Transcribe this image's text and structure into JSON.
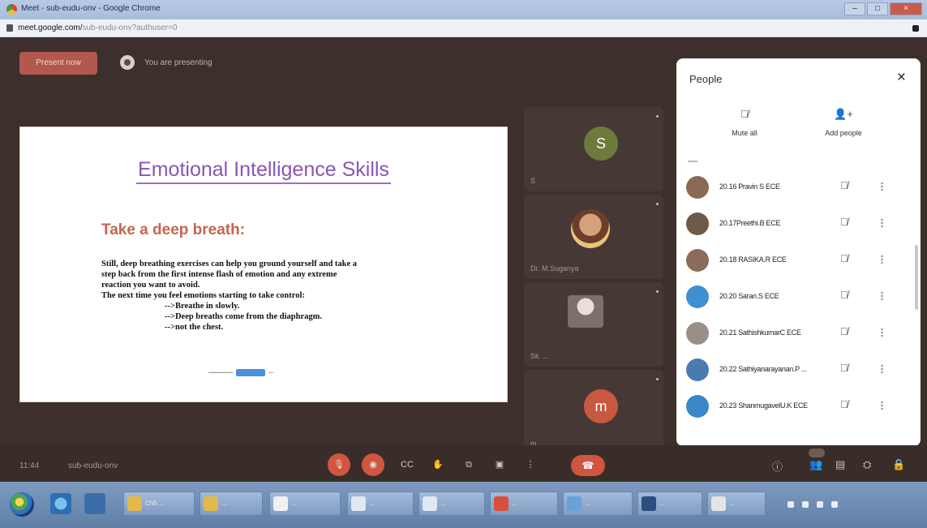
{
  "browser": {
    "title": "Meet - sub-eudu-onv - Google Chrome",
    "url_host": "meet.google.com/",
    "url_path": "sub-eudu-onv?authuser=0"
  },
  "meeting": {
    "presenting_chip": "Present now",
    "presenter_label": "You are presenting",
    "time": "11:44",
    "code": "sub-eudu-onv"
  },
  "slide": {
    "title": "Emotional Intelligence Skills",
    "heading": "Take a deep breath:",
    "body": [
      "Still, deep breathing exercises can help you ground yourself and take a",
      "step back from the first intense flash of emotion and any extreme",
      "reaction you want to avoid.",
      "The next time you feel emotions starting to take control:"
    ],
    "bullets": [
      "-->Breathe in slowly.",
      "-->Deep breaths come from the diaphragm.",
      "-->not the chest."
    ]
  },
  "tiles": [
    {
      "initial": "S",
      "name": "S",
      "color": "#6d7a3c"
    },
    {
      "initial": "",
      "name": "Dr. M.Suganya",
      "color": "#7a5a48"
    },
    {
      "initial": "",
      "name": "Sk. ...",
      "color": "#6e605b"
    },
    {
      "initial": "m",
      "name": "m",
      "color": "#c8583e"
    }
  ],
  "people_panel": {
    "title": "People",
    "close_icon": "×",
    "mute_all_label": "Mute all",
    "add_people_label": "Add people",
    "participants": [
      {
        "name": "20.16 Pravin S ECE",
        "avatar_color": "#8a6a55"
      },
      {
        "name": "20.17Preethi.B ECE",
        "avatar_color": "#6f5a48"
      },
      {
        "name": "20.18 RASIKA.R ECE",
        "avatar_color": "#8d6b5a"
      },
      {
        "name": "20.20 Saran.S ECE",
        "avatar_color": "#3f8fd1"
      },
      {
        "name": "20.21 SathishkumarC ECE",
        "avatar_color": "#9a8f88"
      },
      {
        "name": "20.22 Sathiyanarayanan.P ...",
        "avatar_color": "#4a7bb0"
      },
      {
        "name": "20.23 ShanmugavelU.K ECE",
        "avatar_color": "#3a86c8"
      }
    ]
  },
  "taskbar": {
    "tasks": [
      {
        "label": "Ch5 ...",
        "color": "#e2b94a"
      },
      {
        "label": "...",
        "color": "#e2b94a"
      },
      {
        "label": "...",
        "color": "#f0f0f0"
      },
      {
        "label": "...",
        "color": "#e0e8f4"
      },
      {
        "label": "...",
        "color": "#e0e8f4"
      },
      {
        "label": "...",
        "color": "#d94f3a"
      },
      {
        "label": "...",
        "color": "#6aa1d8"
      },
      {
        "label": "...",
        "color": "#2b4f7e"
      },
      {
        "label": "...",
        "color": "#e5e5e5"
      }
    ]
  }
}
